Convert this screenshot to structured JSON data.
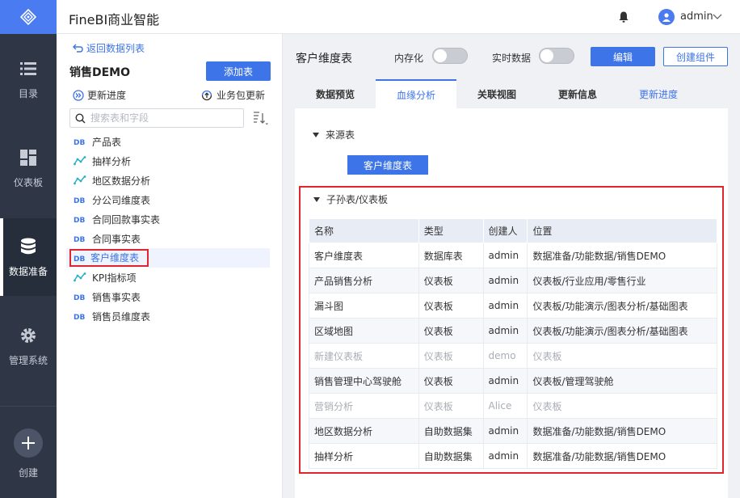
{
  "app": {
    "title": "FineBI商业智能"
  },
  "user": {
    "name": "admin"
  },
  "nav": {
    "items": [
      {
        "label": "目录",
        "icon": "list-icon"
      },
      {
        "label": "仪表板",
        "icon": "dashboard-icon"
      },
      {
        "label": "数据准备",
        "icon": "database-icon"
      },
      {
        "label": "管理系统",
        "icon": "gear-icon"
      }
    ],
    "create_label": "创建"
  },
  "sidebar": {
    "back_label": "返回数据列表",
    "package_title": "销售DEMO",
    "add_table_label": "添加表",
    "update_progress_label": "更新进度",
    "package_update_label": "业务包更新",
    "search_placeholder": "搜索表和字段",
    "tables": [
      {
        "label": "产品表",
        "icon": "db-table-icon"
      },
      {
        "label": "抽样分析",
        "icon": "analysis-icon"
      },
      {
        "label": "地区数据分析",
        "icon": "analysis-icon"
      },
      {
        "label": "分公司维度表",
        "icon": "db-table-icon"
      },
      {
        "label": "合同回款事实表",
        "icon": "db-table-icon"
      },
      {
        "label": "合同事实表",
        "icon": "db-table-icon"
      },
      {
        "label": "客户维度表",
        "icon": "db-table-icon"
      },
      {
        "label": "KPI指标项",
        "icon": "analysis-icon"
      },
      {
        "label": "销售事实表",
        "icon": "db-table-icon"
      },
      {
        "label": "销售员维度表",
        "icon": "db-table-icon"
      }
    ],
    "selected_index": 6
  },
  "main": {
    "title": "客户维度表",
    "memory_label": "内存化",
    "realtime_label": "实时数据",
    "edit_label": "编辑",
    "create_component_label": "创建组件",
    "tabs": [
      {
        "label": "数据预览"
      },
      {
        "label": "血缘分析"
      },
      {
        "label": "关联视图"
      },
      {
        "label": "更新信息"
      },
      {
        "label": "更新进度"
      }
    ],
    "active_tab": 1,
    "source_section_label": "来源表",
    "source_table": "客户维度表",
    "child_section_label": "子孙表/仪表板",
    "grid": {
      "headers": [
        "名称",
        "类型",
        "创建人",
        "位置"
      ],
      "rows": [
        [
          "客户维度表",
          "数据库表",
          "admin",
          "数据准备/功能数据/销售DEMO"
        ],
        [
          "产品销售分析",
          "仪表板",
          "admin",
          "仪表板/行业应用/零售行业"
        ],
        [
          "漏斗图",
          "仪表板",
          "admin",
          "仪表板/功能演示/图表分析/基础图表"
        ],
        [
          "区域地图",
          "仪表板",
          "admin",
          "仪表板/功能演示/图表分析/基础图表"
        ],
        [
          "新建仪表板",
          "仪表板",
          "demo",
          "仪表板"
        ],
        [
          "销售管理中心驾驶舱",
          "仪表板",
          "admin",
          "仪表板/管理驾驶舱"
        ],
        [
          "营销分析",
          "仪表板",
          "Alice",
          "仪表板"
        ],
        [
          "地区数据分析",
          "自助数据集",
          "admin",
          "数据准备/功能数据/销售DEMO"
        ],
        [
          "抽样分析",
          "自助数据集",
          "admin",
          "数据准备/功能数据/销售DEMO"
        ]
      ],
      "dim_rows": [
        4,
        6
      ]
    }
  },
  "colors": {
    "accent": "#3d74e8",
    "nav_bg": "#2f3747",
    "highlight": "#e0252c"
  }
}
